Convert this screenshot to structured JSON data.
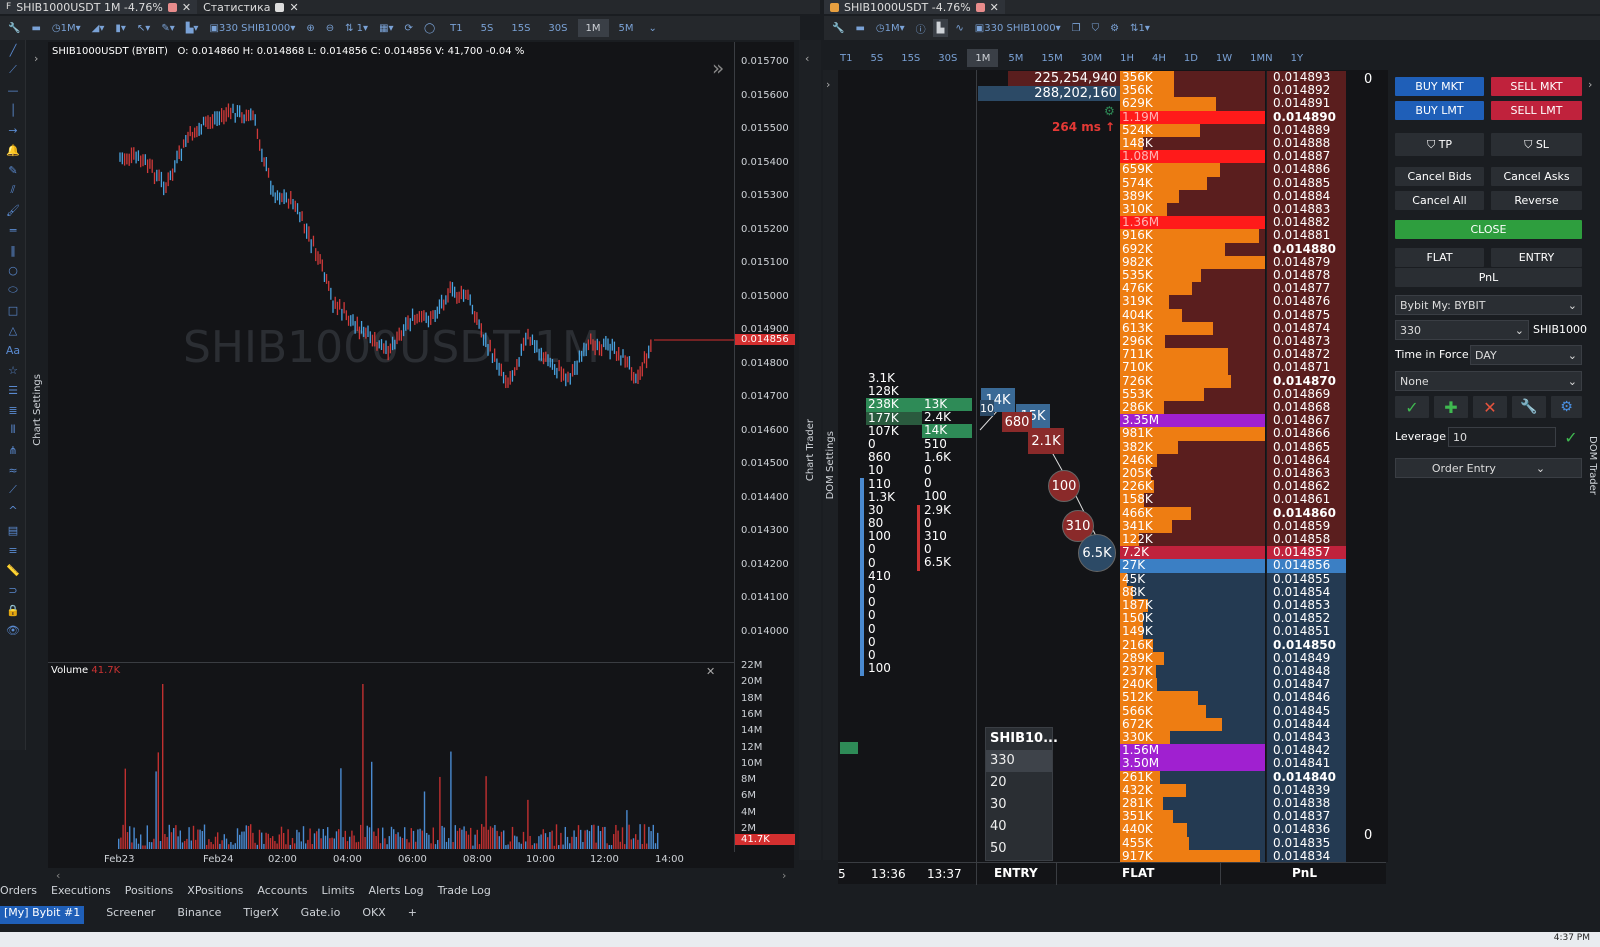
{
  "window_tabs": {
    "left_tab": "SHIB1000USDT 1M -4.76%",
    "stats_tab": "Статистика",
    "right_tab": "SHIB1000USDT -4.76%"
  },
  "left_toolbar": {
    "interval": "1M",
    "symbol": "330 SHIB1000",
    "timeframes": [
      "T1",
      "5S",
      "15S",
      "30S",
      "1M",
      "5M"
    ],
    "selected_tf": "1M"
  },
  "right_toolbar": {
    "interval": "1M",
    "symbol": "330 SHIB1000",
    "counter": "1",
    "timeframes": [
      "T1",
      "5S",
      "15S",
      "30S",
      "1M",
      "5M",
      "15M",
      "30M",
      "1H",
      "4H",
      "1D",
      "1W",
      "1MN",
      "1Y"
    ],
    "selected_tf": "1M"
  },
  "chart": {
    "header": "SHIB1000USDT (BYBIT)",
    "ohlc": "O: 0.014860  H: 0.014868  L: 0.014856  C: 0.014856  V: 41,700  -0.04 %",
    "watermark": "SHIB1000USDT 1M",
    "price_labels": [
      "0.015700",
      "0.015600",
      "0.015500",
      "0.015400",
      "0.015300",
      "0.015200",
      "0.015100",
      "0.015000",
      "0.014900",
      "0.014800",
      "0.014700",
      "0.014600",
      "0.014500",
      "0.014400",
      "0.014300",
      "0.014200",
      "0.014100",
      "0.014000"
    ],
    "last_price": "0.014856",
    "volume_label": "Volume",
    "volume_value": "41.7K",
    "volume_axis": [
      "22M",
      "20M",
      "18M",
      "16M",
      "14M",
      "12M",
      "10M",
      "8M",
      "6M",
      "4M",
      "2M"
    ],
    "volume_last": "41.7K",
    "time_labels": [
      "Feb23",
      "Feb24",
      "02:00",
      "04:00",
      "06:00",
      "08:00",
      "10:00",
      "12:00",
      "14:00"
    ],
    "side_label": "Chart Settings"
  },
  "side_labels": {
    "chart_trader": "Chart Trader",
    "dom_settings": "DOM Settings",
    "dom_trader": "DOM Trader"
  },
  "dom": {
    "top_vol_1": "225,254,940",
    "top_vol_2": "288,202,160",
    "latency": "264 ms",
    "top_right_zero": "0",
    "bottom_right_zero": "0",
    "footer": [
      "ENTRY",
      "FLAT",
      "PnL"
    ],
    "times": [
      "5",
      "13:36",
      "13:37"
    ],
    "cluster_col1": [
      "3.1K",
      "128K",
      "238K",
      "177K",
      "107K",
      "0",
      "860",
      "10",
      "110",
      "1.3K",
      "30",
      "80",
      "100",
      "0",
      "0",
      "410",
      "0",
      "0",
      "0",
      "0",
      "0",
      "0",
      "100"
    ],
    "cluster_col2": [
      "13K",
      "2.4K",
      "14K",
      "510",
      "1.6K",
      "0",
      "0",
      "100",
      "2.9K",
      "0",
      "310",
      "0",
      "6.5K"
    ],
    "bubbles": [
      "14K",
      "15K",
      "680",
      "2.1K",
      "100",
      "310",
      "6.5K"
    ],
    "small_box": "10",
    "qty_popup": [
      "SHIB10...",
      "330",
      "20",
      "30",
      "40",
      "50"
    ],
    "rows": [
      {
        "vol": "356K",
        "price": "0.014893",
        "bold": false,
        "side": "ask"
      },
      {
        "vol": "356K",
        "price": "0.014892",
        "bold": false,
        "side": "ask"
      },
      {
        "vol": "629K",
        "price": "0.014891",
        "bold": false,
        "side": "ask"
      },
      {
        "vol": "1.19M",
        "price": "0.014890",
        "bold": true,
        "side": "ask",
        "hl": "red"
      },
      {
        "vol": "524K",
        "price": "0.014889",
        "bold": false,
        "side": "ask"
      },
      {
        "vol": "148K",
        "price": "0.014888",
        "bold": false,
        "side": "ask"
      },
      {
        "vol": "1.08M",
        "price": "0.014887",
        "bold": false,
        "side": "ask",
        "hl": "red"
      },
      {
        "vol": "659K",
        "price": "0.014886",
        "bold": false,
        "side": "ask"
      },
      {
        "vol": "574K",
        "price": "0.014885",
        "bold": false,
        "side": "ask"
      },
      {
        "vol": "389K",
        "price": "0.014884",
        "bold": false,
        "side": "ask"
      },
      {
        "vol": "310K",
        "price": "0.014883",
        "bold": false,
        "side": "ask"
      },
      {
        "vol": "1.36M",
        "price": "0.014882",
        "bold": false,
        "side": "ask",
        "hl": "red"
      },
      {
        "vol": "916K",
        "price": "0.014881",
        "bold": false,
        "side": "ask"
      },
      {
        "vol": "692K",
        "price": "0.014880",
        "bold": true,
        "side": "ask"
      },
      {
        "vol": "982K",
        "price": "0.014879",
        "bold": false,
        "side": "ask"
      },
      {
        "vol": "535K",
        "price": "0.014878",
        "bold": false,
        "side": "ask"
      },
      {
        "vol": "476K",
        "price": "0.014877",
        "bold": false,
        "side": "ask"
      },
      {
        "vol": "319K",
        "price": "0.014876",
        "bold": false,
        "side": "ask"
      },
      {
        "vol": "404K",
        "price": "0.014875",
        "bold": false,
        "side": "ask"
      },
      {
        "vol": "613K",
        "price": "0.014874",
        "bold": false,
        "side": "ask"
      },
      {
        "vol": "296K",
        "price": "0.014873",
        "bold": false,
        "side": "ask"
      },
      {
        "vol": "711K",
        "price": "0.014872",
        "bold": false,
        "side": "ask"
      },
      {
        "vol": "710K",
        "price": "0.014871",
        "bold": false,
        "side": "ask"
      },
      {
        "vol": "726K",
        "price": "0.014870",
        "bold": true,
        "side": "ask"
      },
      {
        "vol": "553K",
        "price": "0.014869",
        "bold": false,
        "side": "ask"
      },
      {
        "vol": "286K",
        "price": "0.014868",
        "bold": false,
        "side": "ask"
      },
      {
        "vol": "3.35M",
        "price": "0.014867",
        "bold": false,
        "side": "ask",
        "hl": "purple"
      },
      {
        "vol": "981K",
        "price": "0.014866",
        "bold": false,
        "side": "ask"
      },
      {
        "vol": "382K",
        "price": "0.014865",
        "bold": false,
        "side": "ask"
      },
      {
        "vol": "246K",
        "price": "0.014864",
        "bold": false,
        "side": "ask"
      },
      {
        "vol": "205K",
        "price": "0.014863",
        "bold": false,
        "side": "ask"
      },
      {
        "vol": "226K",
        "price": "0.014862",
        "bold": false,
        "side": "ask"
      },
      {
        "vol": "158K",
        "price": "0.014861",
        "bold": false,
        "side": "ask"
      },
      {
        "vol": "466K",
        "price": "0.014860",
        "bold": true,
        "side": "ask"
      },
      {
        "vol": "341K",
        "price": "0.014859",
        "bold": false,
        "side": "ask"
      },
      {
        "vol": "122K",
        "price": "0.014858",
        "bold": false,
        "side": "ask"
      },
      {
        "vol": "7.2K",
        "price": "0.014857",
        "bold": false,
        "side": "ask",
        "hl": "bestask"
      },
      {
        "vol": "27K",
        "price": "0.014856",
        "bold": false,
        "side": "bid",
        "hl": "bestbid"
      },
      {
        "vol": "45K",
        "price": "0.014855",
        "bold": false,
        "side": "bid"
      },
      {
        "vol": "88K",
        "price": "0.014854",
        "bold": false,
        "side": "bid"
      },
      {
        "vol": "187K",
        "price": "0.014853",
        "bold": false,
        "side": "bid"
      },
      {
        "vol": "150K",
        "price": "0.014852",
        "bold": false,
        "side": "bid"
      },
      {
        "vol": "149K",
        "price": "0.014851",
        "bold": false,
        "side": "bid"
      },
      {
        "vol": "216K",
        "price": "0.014850",
        "bold": true,
        "side": "bid"
      },
      {
        "vol": "289K",
        "price": "0.014849",
        "bold": false,
        "side": "bid"
      },
      {
        "vol": "237K",
        "price": "0.014848",
        "bold": false,
        "side": "bid"
      },
      {
        "vol": "240K",
        "price": "0.014847",
        "bold": false,
        "side": "bid"
      },
      {
        "vol": "512K",
        "price": "0.014846",
        "bold": false,
        "side": "bid"
      },
      {
        "vol": "566K",
        "price": "0.014845",
        "bold": false,
        "side": "bid"
      },
      {
        "vol": "672K",
        "price": "0.014844",
        "bold": false,
        "side": "bid"
      },
      {
        "vol": "330K",
        "price": "0.014843",
        "bold": false,
        "side": "bid"
      },
      {
        "vol": "1.56M",
        "price": "0.014842",
        "bold": false,
        "side": "bid",
        "hl": "purple"
      },
      {
        "vol": "3.50M",
        "price": "0.014841",
        "bold": false,
        "side": "bid",
        "hl": "purple"
      },
      {
        "vol": "261K",
        "price": "0.014840",
        "bold": true,
        "side": "bid"
      },
      {
        "vol": "432K",
        "price": "0.014839",
        "bold": false,
        "side": "bid"
      },
      {
        "vol": "281K",
        "price": "0.014838",
        "bold": false,
        "side": "bid"
      },
      {
        "vol": "351K",
        "price": "0.014837",
        "bold": false,
        "side": "bid"
      },
      {
        "vol": "440K",
        "price": "0.014836",
        "bold": false,
        "side": "bid"
      },
      {
        "vol": "455K",
        "price": "0.014835",
        "bold": false,
        "side": "bid"
      },
      {
        "vol": "917K",
        "price": "0.014834",
        "bold": false,
        "side": "bid"
      }
    ]
  },
  "order_panel": {
    "buy_mkt": "BUY MKT",
    "sell_mkt": "SELL MKT",
    "buy_lmt": "BUY LMT",
    "sell_lmt": "SELL LMT",
    "tp": "TP",
    "sl": "SL",
    "cancel_bids": "Cancel Bids",
    "cancel_asks": "Cancel Asks",
    "cancel_all": "Cancel All",
    "reverse": "Reverse",
    "close": "CLOSE",
    "flat": "FLAT",
    "entry": "ENTRY",
    "pnl": "PnL",
    "account": "Bybit My: BYBIT",
    "quantity": "330",
    "symbol": "SHIB1000",
    "tif_label": "Time in Force",
    "tif_value": "DAY",
    "strategy": "None",
    "leverage_label": "Leverage",
    "leverage_value": "10",
    "order_entry": "Order Entry"
  },
  "bottom_tabs": [
    "Orders",
    "Executions",
    "Positions",
    "XPositions",
    "Accounts",
    "Limits",
    "Alerts Log",
    "Trade Log"
  ],
  "bottom_tabs2": [
    "[My] Bybit #1",
    "Screener",
    "Binance",
    "TigerX",
    "Gate.io",
    "OKX",
    "+"
  ],
  "clock": "4:37 PM"
}
